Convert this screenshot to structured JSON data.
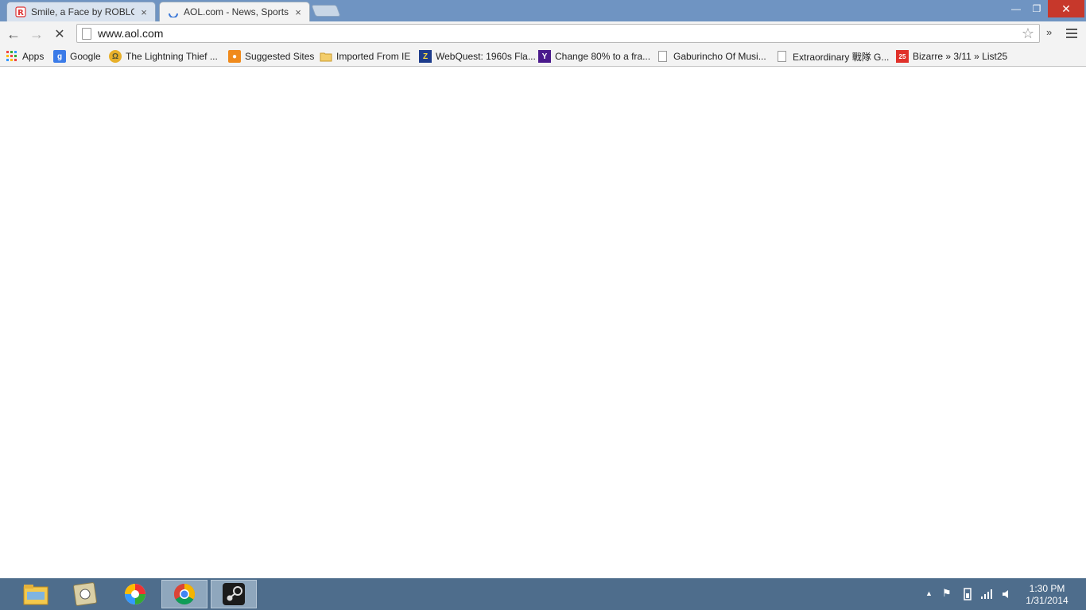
{
  "browser": {
    "tabs": [
      {
        "title": "Smile, a Face by ROBLOX",
        "close": "×",
        "active": false
      },
      {
        "title": "AOL.com - News, Sports, W",
        "close": "×",
        "active": true
      }
    ],
    "window_controls": {
      "minimize": "—",
      "restore": "❐",
      "close": "✕"
    }
  },
  "toolbar": {
    "back": "←",
    "forward": "→",
    "stop": "✕",
    "url": "www.aol.com",
    "bookmark_star": "☆",
    "overflow": "»"
  },
  "bookmarks": [
    {
      "label": "Apps",
      "icon": "apps-grid-icon"
    },
    {
      "label": "Google",
      "icon": "google-icon"
    },
    {
      "label": "The Lightning Thief ...",
      "icon": "lightning-thief-icon"
    },
    {
      "label": "Suggested Sites",
      "icon": "suggested-sites-icon"
    },
    {
      "label": "Imported From IE",
      "icon": "folder-icon"
    },
    {
      "label": "WebQuest: 1960s Fla...",
      "icon": "webquest-icon"
    },
    {
      "label": "Change 80% to a fra...",
      "icon": "yahoo-icon"
    },
    {
      "label": "Gaburincho Of Musi...",
      "icon": "page-icon"
    },
    {
      "label": "Extraordinary 戰隊 G...",
      "icon": "page-icon"
    },
    {
      "label": "Bizarre » 3/11 » List25",
      "icon": "list25-icon"
    }
  ],
  "taskbar": {
    "apps": [
      "file-explorer-icon",
      "scratch-icon",
      "picasa-icon",
      "chrome-icon",
      "steam-icon"
    ],
    "tray": {
      "arrow": "▲",
      "flag": "⚑",
      "signal": "▮▮▮",
      "volume": "◀)"
    },
    "time": "1:30 PM",
    "date": "1/31/2014"
  },
  "colors": {
    "titlebar": "#6f94c2",
    "taskbar": "#4e6d8c",
    "close_button": "#c7382b"
  }
}
